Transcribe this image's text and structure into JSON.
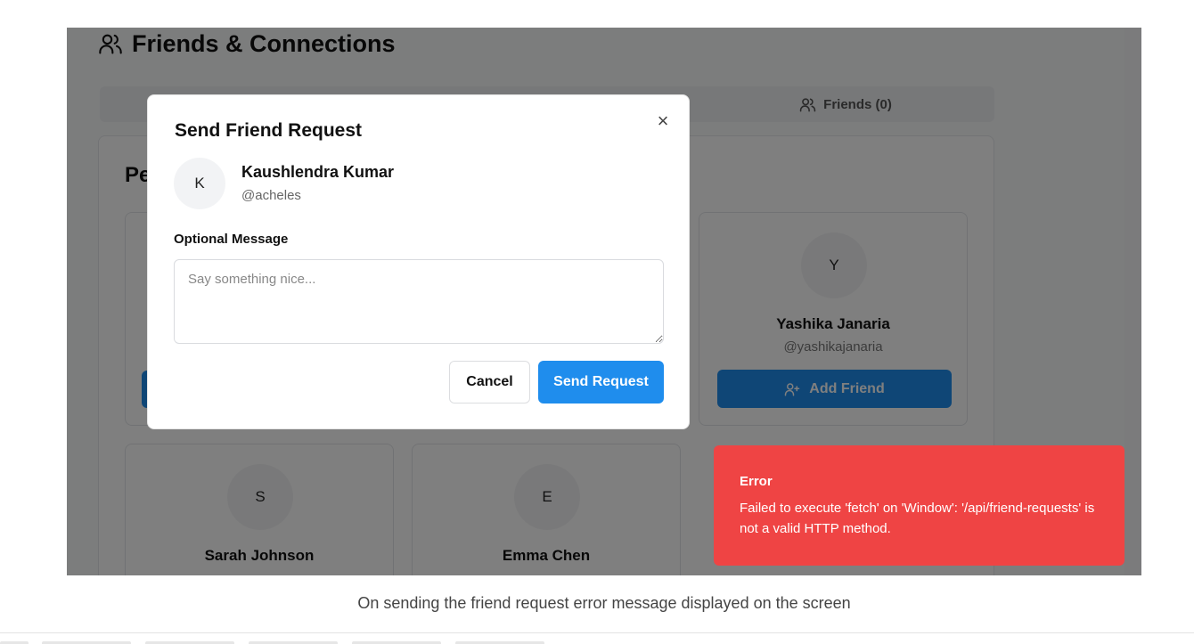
{
  "page": {
    "title": "Friends & Connections",
    "tabs": [
      {
        "label": ""
      },
      {
        "label": ""
      },
      {
        "label": "Friends (0)"
      }
    ],
    "panel_heading": "Pe"
  },
  "cards": [
    {
      "initial": "",
      "name": "",
      "handle": ""
    },
    {
      "initial": "",
      "name": "",
      "handle": ""
    },
    {
      "initial": "Y",
      "name": "Yashika Janaria",
      "handle": "@yashikajanaria",
      "button": "Add Friend"
    },
    {
      "initial": "S",
      "name": "Sarah Johnson",
      "handle": ""
    },
    {
      "initial": "E",
      "name": "Emma Chen",
      "handle": ""
    }
  ],
  "modal": {
    "title": "Send Friend Request",
    "close_symbol": "×",
    "user": {
      "initial": "K",
      "name": "Kaushlendra Kumar",
      "handle": "@acheles"
    },
    "message_label": "Optional Message",
    "message_placeholder": "Say something nice...",
    "message_value": "",
    "cancel_label": "Cancel",
    "send_label": "Send Request"
  },
  "toast": {
    "title": "Error",
    "message": "Failed to execute 'fetch' on 'Window': '/api/friend-requests' is not a valid HTTP method."
  },
  "caption": "On sending the friend request error message displayed on the screen",
  "colors": {
    "primary": "#1f8ded",
    "error": "#ef4444",
    "overlay": "rgba(0,0,0,0.5)"
  },
  "icons": [
    "users-icon",
    "user-plus-icon",
    "close-icon"
  ]
}
